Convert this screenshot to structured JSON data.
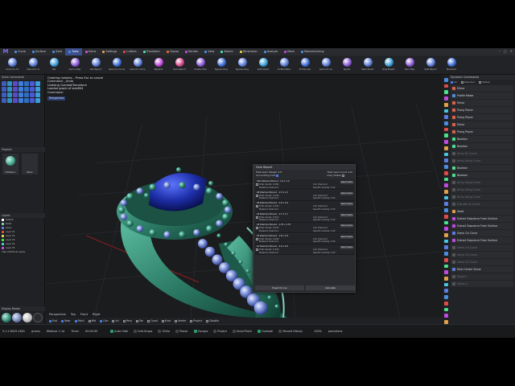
{
  "app": {
    "logo": "M"
  },
  "menu_tabs": [
    {
      "label": "Curve",
      "color": "#4a8de0"
    },
    {
      "label": "Surface",
      "color": "#4a8de0"
    },
    {
      "label": "Solid",
      "color": "#4a8de0"
    },
    {
      "label": "Tools",
      "color": "#4a8de0",
      "active": true
    },
    {
      "label": "Gems",
      "color": "#d04fd0"
    },
    {
      "label": "Settings",
      "color": "#e0a04a"
    },
    {
      "label": "Cutters",
      "color": "#e04a4a"
    },
    {
      "label": "Transform",
      "color": "#4ae0a0"
    },
    {
      "label": "Clayoo",
      "color": "#e06a2a"
    },
    {
      "label": "Render",
      "color": "#c04ae0"
    },
    {
      "label": "View",
      "color": "#4a8de0"
    },
    {
      "label": "Sketch",
      "color": "#4ae0c0"
    },
    {
      "label": "Dimension",
      "color": "#e0d04a"
    },
    {
      "label": "Analyze",
      "color": "#4a8de0"
    },
    {
      "label": "Mesh",
      "color": "#c04ae0"
    },
    {
      "label": "Manufacturing",
      "color": "#4a8de0"
    }
  ],
  "toolbar": [
    {
      "label": "Gems On St",
      "color": "#5d7fd8"
    },
    {
      "label": "Cabochon G",
      "color": "#5d7fd8"
    },
    {
      "label": "Set",
      "color": "#3a9fd8"
    },
    {
      "label": "Gem Cutter",
      "color": "#8c5cd8"
    },
    {
      "label": "Pav Report",
      "color": "#5d7fd8"
    },
    {
      "label": "Gems On Curve",
      "color": "#3d6fd8"
    },
    {
      "label": "Gem On Curve",
      "color": "#5d7fd8"
    },
    {
      "label": "Bag Roll",
      "color": "#c24ad8"
    },
    {
      "label": "Gem Report",
      "color": "#d84a8c"
    },
    {
      "label": "Create Hole",
      "color": "#8c5cd8"
    },
    {
      "label": "Bypass Ring",
      "color": "#3d6fd8"
    },
    {
      "label": "Bypass Ring",
      "color": "#5d7fd8"
    },
    {
      "label": "Split Shank",
      "color": "#3a9fd8"
    },
    {
      "label": "Profile Maker",
      "color": "#5d7fd8"
    },
    {
      "label": "Profile Cap",
      "color": "#3d6fd8"
    },
    {
      "label": "Gems On Cu",
      "color": "#5d7fd8"
    },
    {
      "label": "Signet",
      "color": "#8c5cd8"
    },
    {
      "label": "Mark Studio",
      "color": "#5d7fd8"
    },
    {
      "label": "Ring Master",
      "color": "#3a9fd8"
    },
    {
      "label": "Gem Map",
      "color": "#8c5cd8"
    },
    {
      "label": "Split Report",
      "color": "#5d7fd8"
    },
    {
      "label": "Manufact",
      "color": "#3d6fd8"
    }
  ],
  "command_log": [
    "Creating meshes... Press Esc to cancel",
    "Command: _Undo",
    "Undoing GumballTransform",
    "Loaded graph of size804",
    "Command:"
  ],
  "viewport": {
    "label": "Perspective",
    "tabs": [
      "Perspective",
      "Top",
      "Front",
      "Right"
    ]
  },
  "snaps": [
    {
      "label": "End",
      "on": true
    },
    {
      "label": "Near",
      "on": true
    },
    {
      "label": "Point",
      "on": true
    },
    {
      "label": "Mid",
      "on": false
    },
    {
      "label": "Cen",
      "on": true
    },
    {
      "label": "Int",
      "on": false
    },
    {
      "label": "Perp",
      "on": false
    },
    {
      "label": "Tan",
      "on": false
    },
    {
      "label": "Quad",
      "on": false
    },
    {
      "label": "Knot",
      "on": false
    },
    {
      "label": "Vertex",
      "on": false
    },
    {
      "label": "Project",
      "on": false
    },
    {
      "label": "Disable",
      "on": false
    }
  ],
  "left_panel": {
    "quick_commands": "Quick Commands",
    "projects": "Projects",
    "project_items": [
      {
        "label": "Halfsets 1"
      },
      {
        "label": "Blank"
      }
    ],
    "layers": "Layers",
    "layer_rows": [
      {
        "name": "Default",
        "color": "#ffffff"
      },
      {
        "name": "Metal",
        "color": "#7ad0b0"
      },
      {
        "name": "Gems",
        "color": "#5c7de0"
      },
      {
        "name": "Layer 01",
        "color": "#e04a4a"
      },
      {
        "name": "Layer 02",
        "color": "#e0d04a"
      },
      {
        "name": "Layer 03",
        "color": "#4ae04a"
      },
      {
        "name": "Layer 04",
        "color": "#4ac6e0"
      },
      {
        "name": "Layer 05",
        "color": "#c04ae0"
      }
    ],
    "add_layers": "View Additional Layers",
    "display_modes": "Display Modes"
  },
  "right_panel": {
    "title": "Dynamic Commands",
    "filter_all": "All",
    "filter_selected": "Selected",
    "filter_visible": "Visible",
    "commands": [
      {
        "label": "Mirror",
        "color": "#e0604a"
      },
      {
        "label": "Profile Maker",
        "color": "#4a8de0"
      },
      {
        "label": "Mirror",
        "color": "#e0604a"
      },
      {
        "label": "Prong Placer",
        "color": "#e0604a"
      },
      {
        "label": "Prong Placer",
        "color": "#e0604a"
      },
      {
        "label": "Mirror",
        "color": "#e0604a"
      },
      {
        "label": "Prong Placer",
        "color": "#e0604a"
      },
      {
        "label": "Boolean",
        "color": "#4ae08c"
      },
      {
        "label": "Boolean",
        "color": "#4ae08c"
      },
      {
        "label": "Array On Curve",
        "color": "#555",
        "dim": true
      },
      {
        "label": "Array Along Curve",
        "color": "#555",
        "dim": true
      },
      {
        "label": "Boolean",
        "color": "#4ae08c"
      },
      {
        "label": "Boolean",
        "color": "#4ae08c"
      },
      {
        "label": "Array Along Curve",
        "color": "#555",
        "dim": true
      },
      {
        "label": "Array Along Curve",
        "color": "#555",
        "dim": true
      },
      {
        "label": "Array Along Curve",
        "color": "#555",
        "dim": true
      },
      {
        "label": "Extrude On Curve",
        "color": "#555",
        "dim": true
      },
      {
        "label": "Head",
        "color": "#e0a04a"
      },
      {
        "label": "Extract Sequence From Surface",
        "color": "#c04ae0"
      },
      {
        "label": "Extract Sequence From Surface",
        "color": "#c04ae0"
      },
      {
        "label": "Gems On Curve",
        "color": "#5c7de0"
      },
      {
        "label": "Extract Sequence From Surface",
        "color": "#c04ae0"
      },
      {
        "label": "Gems On Curve",
        "color": "#555",
        "dim": true
      },
      {
        "label": "Gems On Curve",
        "color": "#555",
        "dim": true
      },
      {
        "label": "Gems On Curve",
        "color": "#555",
        "dim": true
      },
      {
        "label": "Main Center Stone",
        "color": "#5c7de0"
      },
      {
        "label": "Shank 1",
        "color": "#555",
        "dim": true
      },
      {
        "label": "Shank 2",
        "color": "#555",
        "dim": true
      }
    ]
  },
  "gem_report": {
    "title": "Gem Report",
    "total_gem_weight_label": "Total Gem Weight",
    "total_gem_weight": "2.8",
    "total_gem_count_label": "Total Gem Count",
    "total_gem_count": "110",
    "accounting_cost_label": "Accounting Cost",
    "only_visible_label": "Only Visible",
    "select_label": "Select Gems",
    "rows": [
      {
        "head": "190 Diamond Round - 1.0 x 1.0",
        "carats": "Total Carats: 0.380",
        "material": "Material: Diamond",
        "cut": "Cut: Diamond",
        "sg": "Specific Gravity: 3.52"
      },
      {
        "head": "26 Diamond Round - 1.3 x 1.3",
        "carats": "Total Carats: 0.220",
        "material": "Material: Diamond",
        "cut": "Cut: Diamond",
        "sg": "Specific Gravity: 3.52"
      },
      {
        "head": "26 Diamond Round - 1.6 x 1.6",
        "carats": "Total Carats: 0.420",
        "material": "Material: Diamond",
        "cut": "Cut: Diamond",
        "sg": "Specific Gravity: 3.52"
      },
      {
        "head": "24 Diamond Round - 1.7 x 1.7",
        "carats": "Total Carats: 0.510",
        "material": "Material: Diamond",
        "cut": "Cut: Diamond",
        "sg": "Specific Gravity: 3.52"
      },
      {
        "head": "24 Diamond Round - 1.75 x 1.75",
        "carats": "Total Carats: 0.670",
        "material": "Material: Diamond",
        "cut": "Cut: Diamond",
        "sg": "Specific Gravity: 3.52"
      },
      {
        "head": "24 Diamond Round - 1.8 x 1.8",
        "carats": "Total Carats: 0.600",
        "material": "Material: Diamond",
        "cut": "Cut: Diamond",
        "sg": "Specific Gravity: 3.52"
      },
      {
        "head": "10 Diamond Round - 2.0 x 2.0",
        "carats": "Total Carats: 0.330",
        "material": "Material: Diamond",
        "cut": "Cut: Diamond",
        "sg": "Specific Gravity: 3.52"
      }
    ],
    "export_label": "Export to csv",
    "calculate_label": "Calculate"
  },
  "statusbar": {
    "version": "5.1.2.8425.2601",
    "unit": "grams",
    "items": "Webinar 1.1d",
    "timer": "Timer",
    "time": "00:00:00",
    "toggles": [
      {
        "label": "Auto Hide",
        "on": true
      },
      {
        "label": "Grid Snaps",
        "on": false
      },
      {
        "label": "Ortho",
        "on": false
      },
      {
        "label": "Planar",
        "on": false
      },
      {
        "label": "Osnaps",
        "on": true
      },
      {
        "label": "Project",
        "on": false
      },
      {
        "label": "SmartTrack",
        "on": false
      },
      {
        "label": "Gumball",
        "on": true
      },
      {
        "label": "Record History",
        "on": false
      }
    ],
    "zoom": "100%",
    "material": "pannelans"
  }
}
